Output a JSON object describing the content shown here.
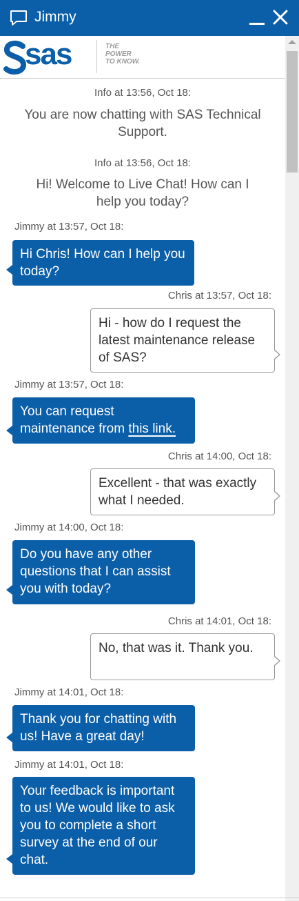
{
  "window": {
    "title": "Jimmy"
  },
  "logo": {
    "brand": "sas",
    "tagline": [
      "THE",
      "POWER",
      "TO KNOW."
    ]
  },
  "messages": [
    {
      "type": "info",
      "meta": "Info at 13:56, Oct 18:",
      "text": "You are now chatting with SAS Technical Support."
    },
    {
      "type": "info",
      "meta": "Info at 13:56, Oct 18:",
      "text": "Hi! Welcome to Live Chat! How can I help you today?"
    },
    {
      "type": "agent",
      "meta": "Jimmy at 13:57, Oct 18:",
      "text": "Hi Chris! How can I help you today?"
    },
    {
      "type": "user",
      "meta": "Chris at 13:57, Oct 18:",
      "text": "Hi - how do I request the latest maintenance release of SAS?"
    },
    {
      "type": "agent",
      "meta": "Jimmy at 13:57, Oct 18:",
      "text": "You can request maintenance from",
      "link": "this link."
    },
    {
      "type": "user",
      "meta": "Chris at 14:00, Oct 18:",
      "text": "Excellent - that was exactly what I needed."
    },
    {
      "type": "agent",
      "meta": "Jimmy at 14:00, Oct 18:",
      "text": "Do you have any other questions that I can assist you with today?"
    },
    {
      "type": "user",
      "meta": "Chris at 14:01, Oct 18:",
      "text": "No, that was it. Thank you."
    },
    {
      "type": "agent",
      "meta": "Jimmy at 14:01, Oct 18:",
      "text": "Thank you for chatting with us! Have a great day!"
    },
    {
      "type": "agent",
      "meta": "Jimmy at 14:01, Oct 18:",
      "text": "Your feedback is important to us! We would like to ask you to complete a short survey at the end of our chat."
    }
  ],
  "colors": {
    "brand_blue": "#0b5ea8",
    "user_bubble_border": "#999999",
    "meta_text": "#555555"
  },
  "icons": {
    "chat": "speech-bubble-icon",
    "minimize": "minimize-icon",
    "close": "close-icon"
  }
}
